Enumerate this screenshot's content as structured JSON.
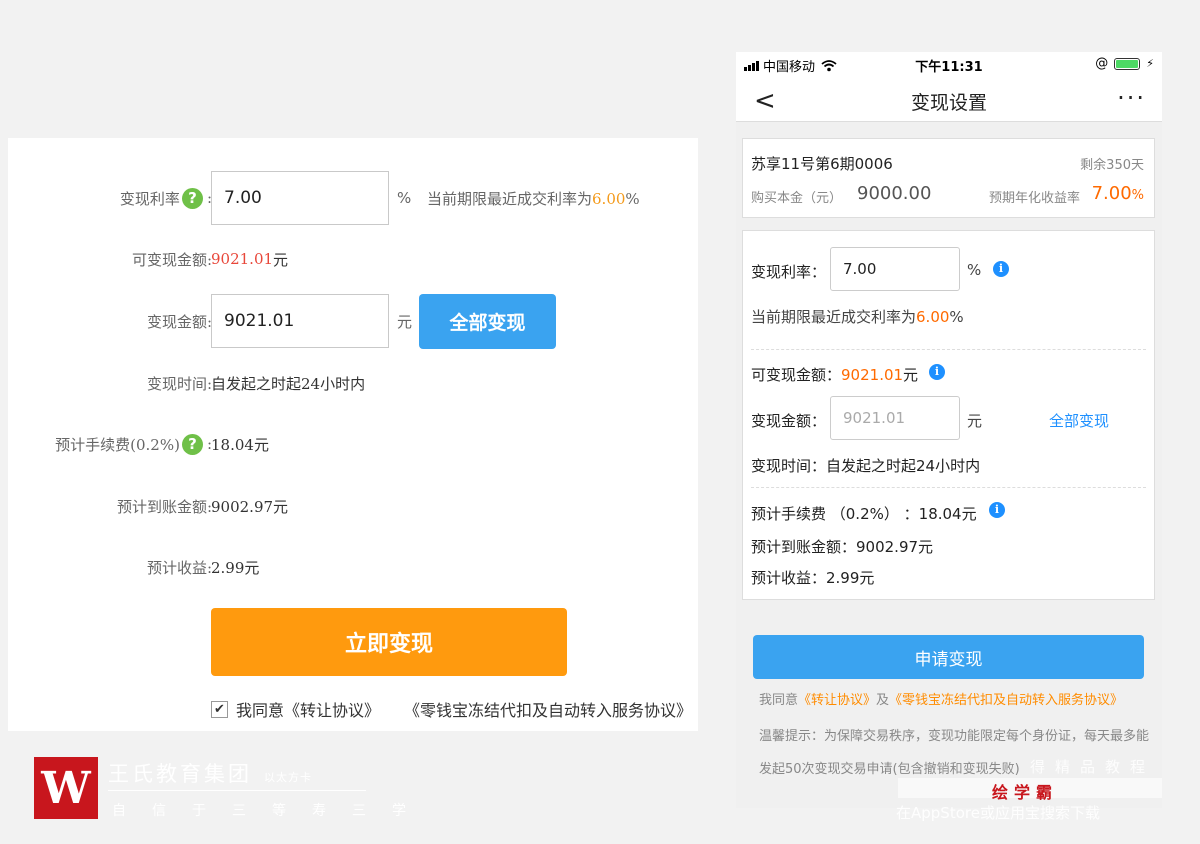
{
  "web": {
    "rate_label": "变现利率",
    "colon": ":",
    "rate_value": "7.00",
    "rate_unit": "%",
    "rate_hint_prefix": "当前期限最近成交利率为",
    "rate_hint_value": "6.00",
    "rate_hint_suffix": "%",
    "available_label": "可变现金额:",
    "available_value": "9021.01",
    "available_unit": "元",
    "amount_label": "变现金额:",
    "amount_value": "9021.01",
    "amount_unit": "元",
    "all_button": "全部变现",
    "time_label": "变现时间:",
    "time_value": "自发起之时起24小时内",
    "fee_label": "预计手续费(0.2%)",
    "fee_value": "18.04元",
    "arrival_label": "预计到账金额:",
    "arrival_value": "9002.97元",
    "income_label": "预计收益:",
    "income_value": "2.99元",
    "submit_button": "立即变现",
    "agree_text": "我同意",
    "agreement1": "《转让协议》",
    "agreement2": "《零钱宝冻结代扣及自动转入服务协议》",
    "help_icon": "?"
  },
  "logo": {
    "mark": "W",
    "name": "王氏教育集团",
    "name_suffix": "以太方卡",
    "sub": "自信于三等寿三学"
  },
  "phone": {
    "status": {
      "carrier": "中国移动",
      "wifi": "wifi-icon",
      "time": "下午11:31",
      "lock": "@"
    },
    "nav": {
      "back": "<",
      "title": "变现设置",
      "more": "···"
    },
    "product": {
      "name": "苏享11号第6期0006",
      "remain": "剩余350天",
      "principal_label": "购买本金（元）",
      "principal_value": "9000.00",
      "yield_label": "预期年化收益率",
      "yield_value": "7.00",
      "yield_unit": "%"
    },
    "form": {
      "rate_label": "变现利率：",
      "rate_value": "7.00",
      "rate_unit": "%",
      "rate_hint_prefix": "当前期限最近成交利率为",
      "rate_hint_value": "6.00",
      "rate_hint_suffix": "%",
      "available_label": "可变现金额：",
      "available_value": "9021.01",
      "available_unit": "元",
      "amount_label": "变现金额：",
      "amount_placeholder": "9021.01",
      "amount_unit": "元",
      "all_link": "全部变现",
      "time_label": "变现时间：",
      "time_value": "自发起之时起24小时内",
      "fee_text": "预计手续费 （0.2%） ：18.04元",
      "arrival_text": "预计到账金额：9002.97元",
      "income_text": "预计收益：2.99元",
      "info_icon": "i"
    },
    "submit_button": "申请变现",
    "agree_prefix": "我同意",
    "agreement1": "《转让协议》",
    "agree_and": "及",
    "agreement2": "《零钱宝冻结代扣及自动转入服务协议》",
    "tip": "温馨提示：为保障交易秩序，变现功能限定每个身份证，每天最多能发起50次变现交易申请(包含撤销和变现失败)"
  },
  "watermark": {
    "line1": "得精品教程",
    "brand": "绘学霸",
    "line3": "在AppStore或应用宝搜索下载"
  },
  "colors": {
    "accent_blue": "#3aa3f0",
    "accent_orange": "#ff9a0e",
    "highlight_red": "#e8473a",
    "help_green": "#6fc048",
    "logo_red": "#c8161d"
  }
}
